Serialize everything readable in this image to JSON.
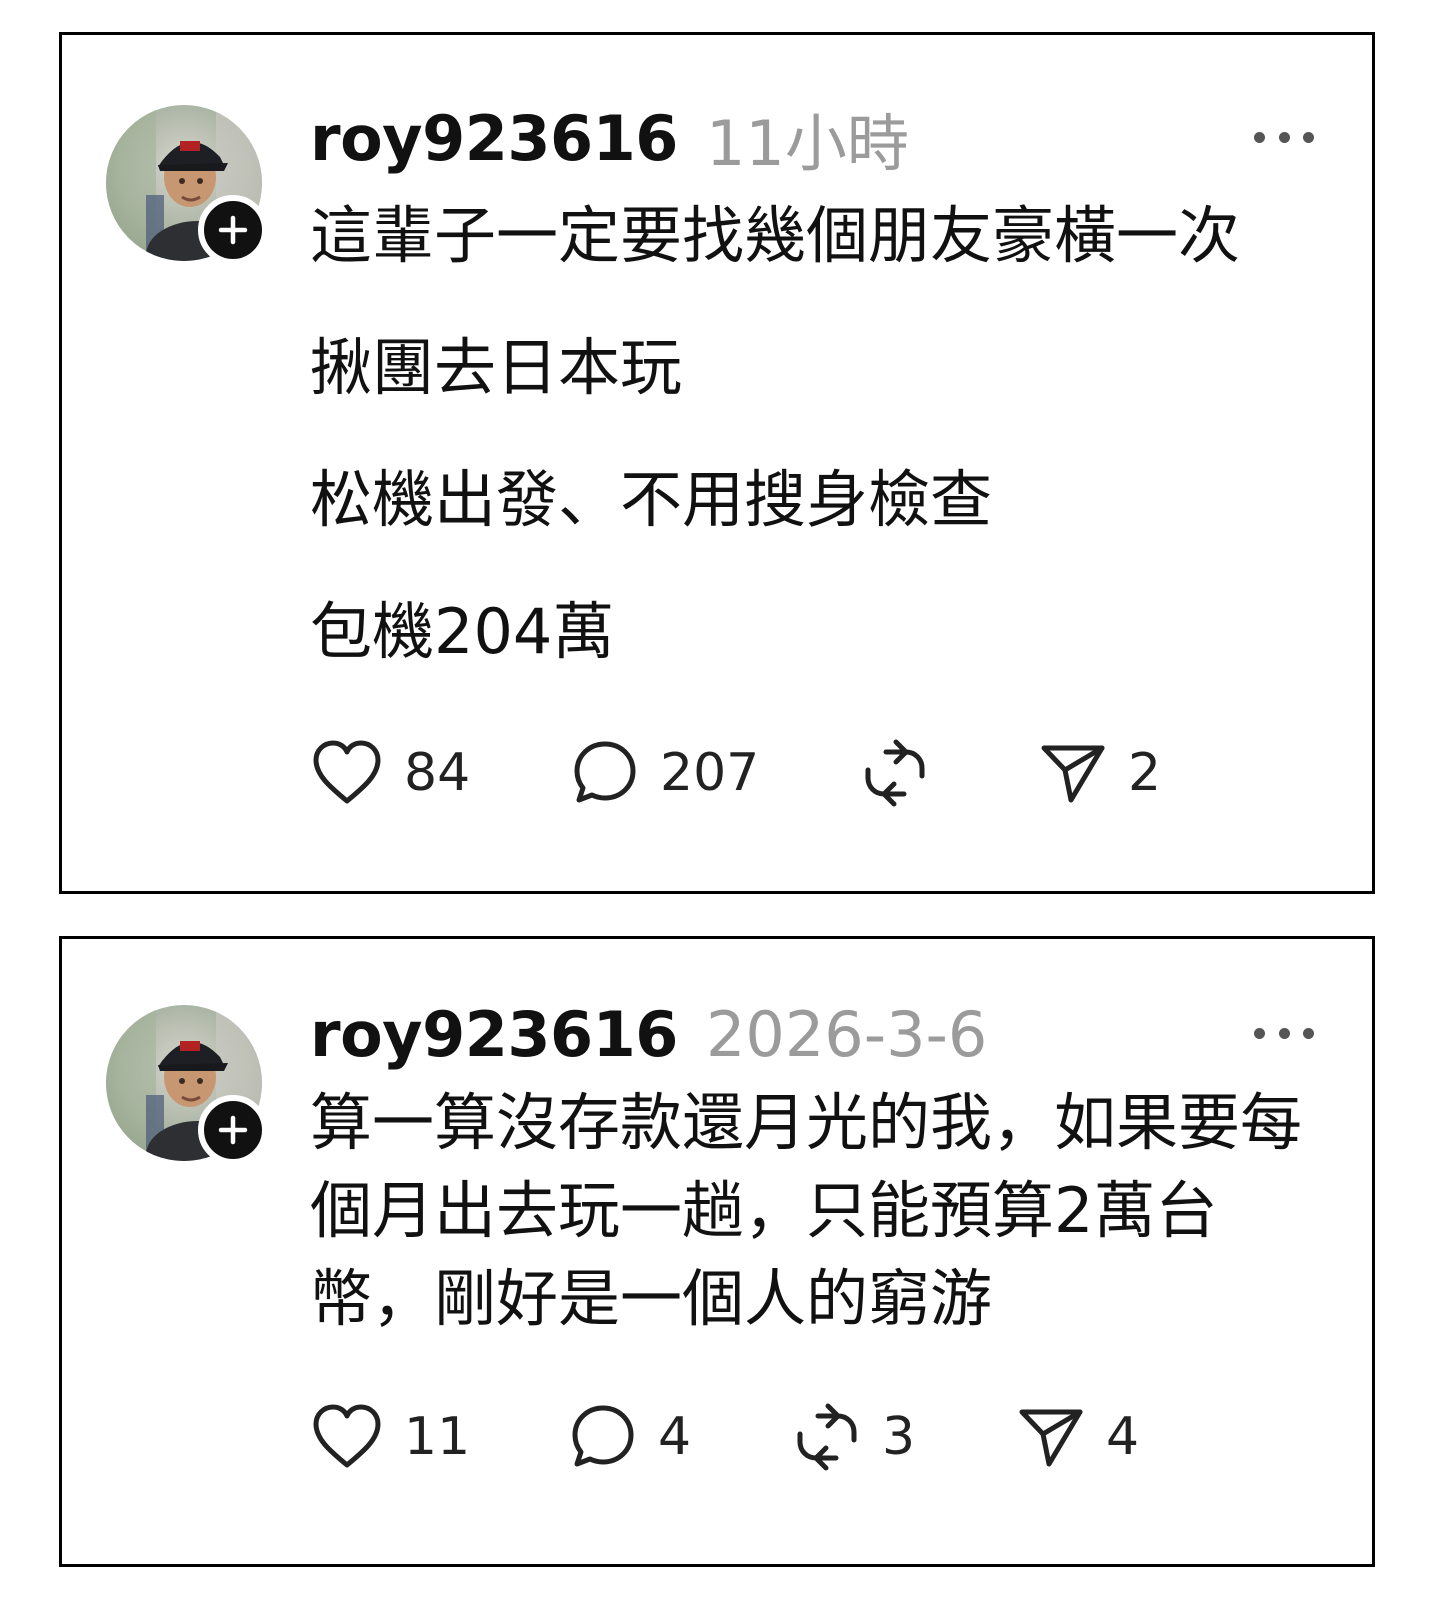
{
  "posts": [
    {
      "username": "roy923616",
      "timestamp": "11小時",
      "lines": [
        "這輩子一定要找幾個朋友豪橫一次",
        "揪團去日本玩",
        "松機出發、不用搜身檢查",
        "包機204萬"
      ],
      "stats": {
        "likes": "84",
        "comments": "207",
        "reposts": "",
        "shares": "2"
      }
    },
    {
      "username": "roy923616",
      "timestamp": "2026-3-6",
      "text": "算一算沒存款還月光的我，如果要每個月出去玩一趟，只能預算2萬台幣，剛好是一個人的窮游",
      "stats": {
        "likes": "11",
        "comments": "4",
        "reposts": "3",
        "shares": "4"
      }
    }
  ],
  "icons": {
    "like": "heart-icon",
    "comment": "comment-bubble-icon",
    "repost": "repost-icon",
    "share": "send-icon",
    "more": "more-dots-icon",
    "follow": "plus-icon"
  },
  "colors": {
    "text": "#111111",
    "timestamp": "#9b9b9b",
    "border": "#000000",
    "icon": "#222222"
  }
}
